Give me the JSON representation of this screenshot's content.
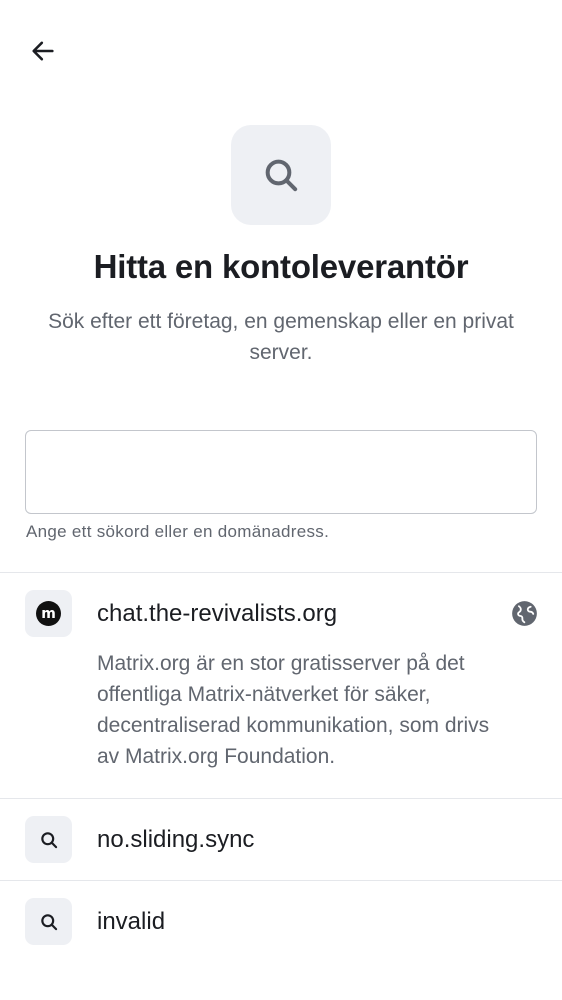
{
  "header": {
    "back_icon": "arrow-left-icon"
  },
  "hero": {
    "icon": "search-icon",
    "title": "Hitta en kontoleverantör",
    "subtitle": "Sök efter ett företag, en gemenskap eller en privat server."
  },
  "search": {
    "value": "",
    "placeholder": "",
    "helper": "Ange ett sökord eller en domänadress."
  },
  "results": [
    {
      "name": "chat.the-revivalists.org",
      "icon": "matrix-logo-icon",
      "icon_letter": "m",
      "description": "Matrix.org är en stor gratisserver på det offentliga Matrix-nätverket för säker, decentraliserad kommunikation, som drivs av Matrix.org Foundation.",
      "trailing_icon": "globe-icon"
    },
    {
      "name": "no.sliding.sync",
      "icon": "search-icon"
    },
    {
      "name": "invalid",
      "icon": "search-icon"
    }
  ],
  "colors": {
    "text_primary": "#1b1d22",
    "text_secondary": "#61666f",
    "icon_bg": "#eef0f4",
    "divider": "#e5e7eb"
  }
}
